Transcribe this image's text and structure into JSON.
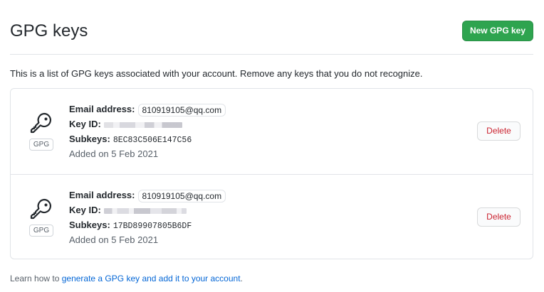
{
  "header": {
    "title": "GPG keys",
    "new_key_label": "New GPG key"
  },
  "intro_text": "This is a list of GPG keys associated with your account. Remove any keys that you do not recognize.",
  "labels": {
    "email": "Email address:",
    "key_id": "Key ID:",
    "subkeys": "Subkeys:",
    "gpg_badge": "GPG",
    "delete": "Delete"
  },
  "keys": [
    {
      "email": "810919105@qq.com",
      "subkeys": "8EC83C506E147C56",
      "added": "Added on 5 Feb 2021"
    },
    {
      "email": "810919105@qq.com",
      "subkeys": "17BD89907805B6DF",
      "added": "Added on 5 Feb 2021"
    }
  ],
  "footer": {
    "prefix": "Learn how to ",
    "link_text": "generate a GPG key and add it to your account",
    "suffix": "."
  },
  "colors": {
    "primary_button": "#2ea44f",
    "danger_text": "#cb2431",
    "link": "#0366d6",
    "border": "#e1e4e8"
  },
  "icons": {
    "key": "key-icon"
  }
}
